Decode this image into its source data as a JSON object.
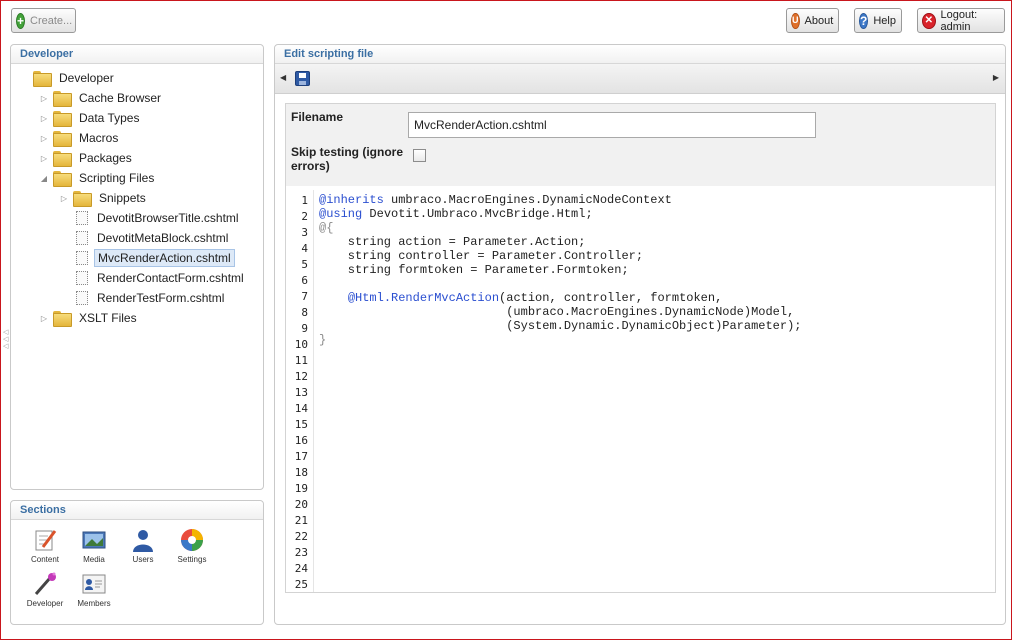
{
  "topbar": {
    "create_label": "Create...",
    "about_label": "About",
    "help_label": "Help",
    "logout_label": "Logout: admin"
  },
  "developer_panel": {
    "title": "Developer",
    "tree": [
      {
        "label": "Developer",
        "type": "folder",
        "level": 0,
        "expander": "none"
      },
      {
        "label": "Cache Browser",
        "type": "folder",
        "level": 1,
        "expander": "collapsed"
      },
      {
        "label": "Data Types",
        "type": "folder",
        "level": 1,
        "expander": "collapsed"
      },
      {
        "label": "Macros",
        "type": "folder",
        "level": 1,
        "expander": "collapsed"
      },
      {
        "label": "Packages",
        "type": "folder",
        "level": 1,
        "expander": "collapsed"
      },
      {
        "label": "Scripting Files",
        "type": "folder",
        "level": 1,
        "expander": "expanded"
      },
      {
        "label": "Snippets",
        "type": "folder",
        "level": 2,
        "expander": "collapsed"
      },
      {
        "label": "DevotitBrowserTitle.cshtml",
        "type": "file",
        "level": 2,
        "expander": "none"
      },
      {
        "label": "DevotitMetaBlock.cshtml",
        "type": "file",
        "level": 2,
        "expander": "none"
      },
      {
        "label": "MvcRenderAction.cshtml",
        "type": "file",
        "level": 2,
        "expander": "none",
        "selected": true
      },
      {
        "label": "RenderContactForm.cshtml",
        "type": "file",
        "level": 2,
        "expander": "none"
      },
      {
        "label": "RenderTestForm.cshtml",
        "type": "file",
        "level": 2,
        "expander": "none"
      },
      {
        "label": "XSLT Files",
        "type": "folder",
        "level": 1,
        "expander": "collapsed"
      }
    ]
  },
  "sections_panel": {
    "title": "Sections",
    "items": [
      {
        "label": "Content",
        "icon": "content-icon"
      },
      {
        "label": "Media",
        "icon": "media-icon"
      },
      {
        "label": "Users",
        "icon": "users-icon"
      },
      {
        "label": "Settings",
        "icon": "settings-icon"
      },
      {
        "label": "Developer",
        "icon": "developer-icon"
      },
      {
        "label": "Members",
        "icon": "members-icon"
      }
    ]
  },
  "editor": {
    "title": "Edit scripting file",
    "filename_label": "Filename",
    "filename_value": "MvcRenderAction.cshtml",
    "skip_label": "Skip testing (ignore errors)",
    "skip_checked": false,
    "line_count": 25,
    "code_lines": [
      [
        {
          "t": "@inherits",
          "c": "kw"
        },
        {
          "t": " umbraco.MacroEngines.DynamicNodeContext",
          "c": ""
        }
      ],
      [
        {
          "t": "@using",
          "c": "kw"
        },
        {
          "t": " Devotit.Umbraco.MvcBridge.Html;",
          "c": ""
        }
      ],
      [
        {
          "t": "@{",
          "c": "gray"
        }
      ],
      [
        {
          "t": "    string action = Parameter.Action;",
          "c": ""
        }
      ],
      [
        {
          "t": "    string controller = Parameter.Controller;",
          "c": ""
        }
      ],
      [
        {
          "t": "    string formtoken = Parameter.Formtoken;",
          "c": ""
        }
      ],
      [],
      [
        {
          "t": "    ",
          "c": ""
        },
        {
          "t": "@Html.RenderMvcAction",
          "c": "kw"
        },
        {
          "t": "(action, controller, formtoken,",
          "c": ""
        }
      ],
      [
        {
          "t": "                          (umbraco.MacroEngines.DynamicNode)Model,",
          "c": ""
        }
      ],
      [
        {
          "t": "                          (System.Dynamic.DynamicObject)Parameter);",
          "c": ""
        }
      ],
      [
        {
          "t": "}",
          "c": "gray"
        }
      ]
    ]
  }
}
